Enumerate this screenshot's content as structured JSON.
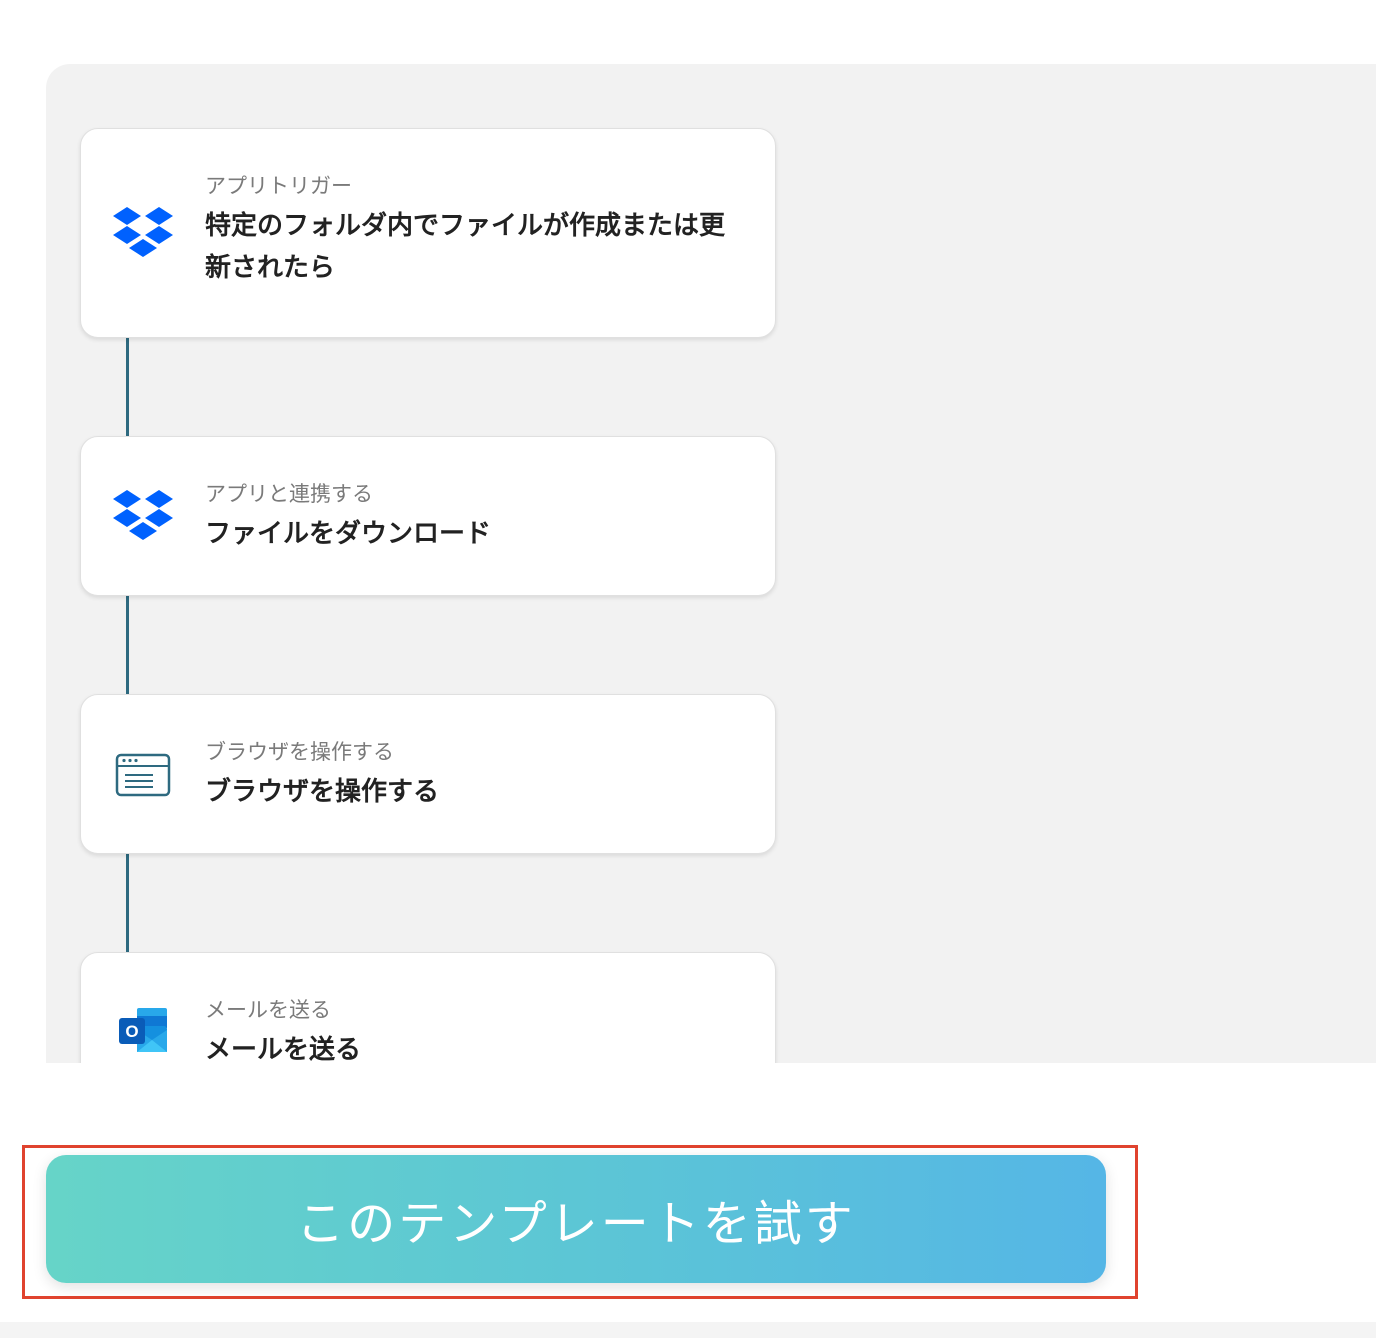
{
  "flow": {
    "steps": [
      {
        "type": "アプリトリガー",
        "title": "特定のフォルダ内でファイルが作成または更新されたら",
        "icon": "dropbox-icon"
      },
      {
        "type": "アプリと連携する",
        "title": "ファイルをダウンロード",
        "icon": "dropbox-icon"
      },
      {
        "type": "ブラウザを操作する",
        "title": "ブラウザを操作する",
        "icon": "browser-icon"
      },
      {
        "type": "メールを送る",
        "title": "メールを送る",
        "icon": "outlook-icon"
      }
    ]
  },
  "cta": {
    "label": "このテンプレートを試す"
  },
  "colors": {
    "connector": "#2e6a80",
    "dropbox": "#0061fe",
    "highlight": "#e0432e",
    "cta_gradient_start": "#66d4c8",
    "cta_gradient_end": "#55b6e6"
  }
}
